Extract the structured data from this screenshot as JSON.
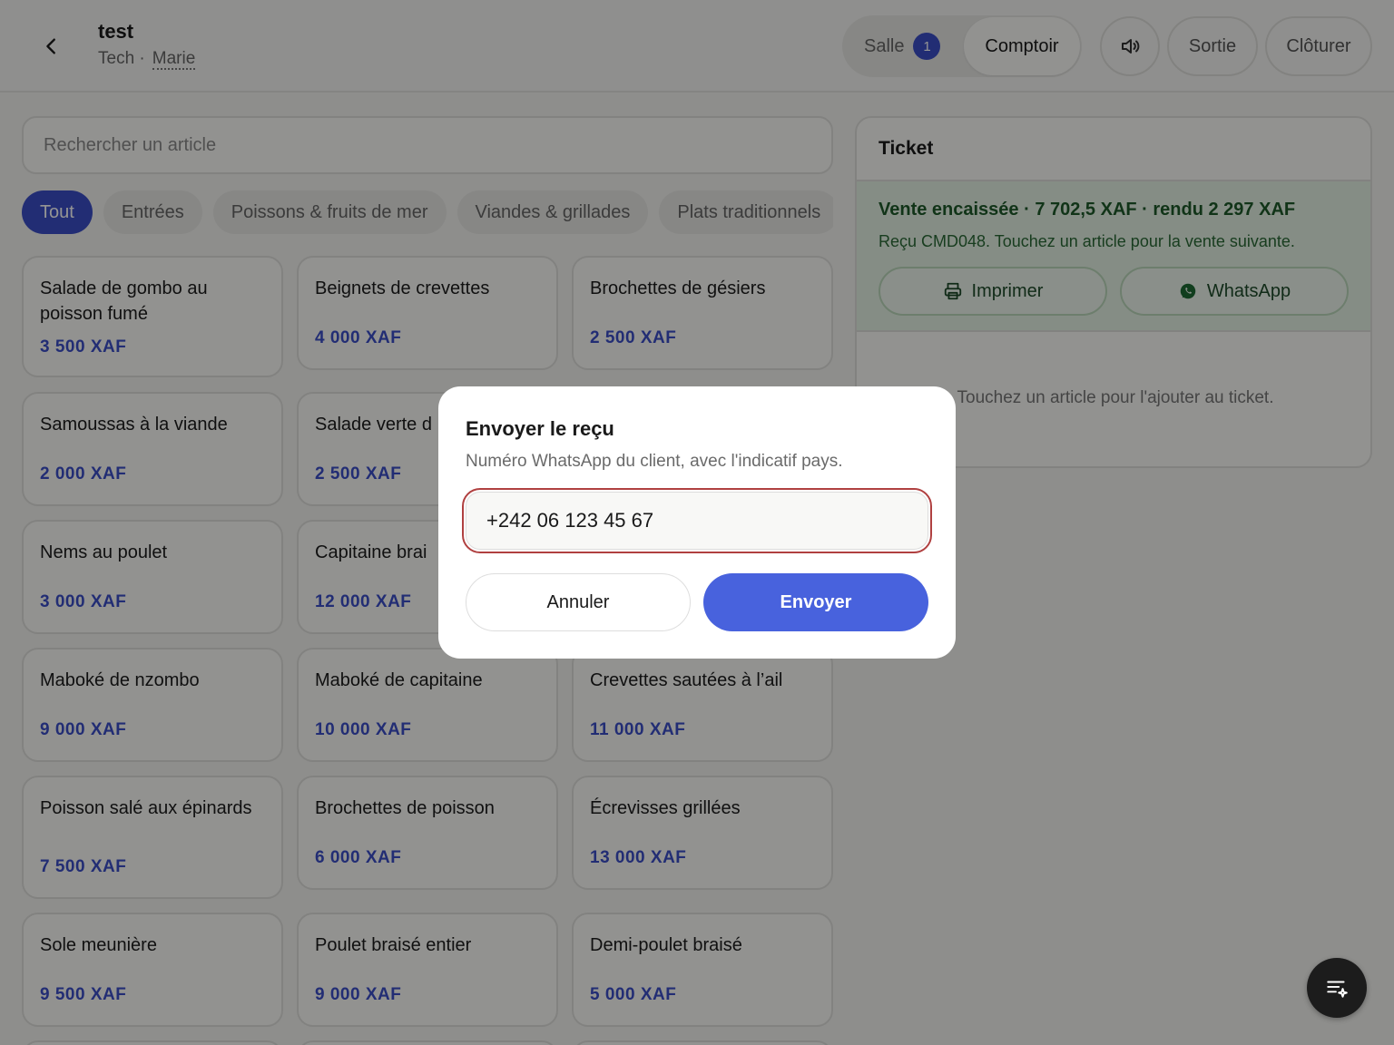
{
  "header": {
    "title": "test",
    "subtitle_role": "Tech ·",
    "subtitle_user": "Marie",
    "mode_salle": "Salle",
    "mode_salle_badge": "1",
    "mode_comptoir": "Comptoir",
    "sound_icon": "speaker-icon",
    "sortie_label": "Sortie",
    "cloturer_label": "Clôturer"
  },
  "search": {
    "placeholder": "Rechercher un article"
  },
  "categories": [
    {
      "label": "Tout",
      "active": true
    },
    {
      "label": "Entrées"
    },
    {
      "label": "Poissons & fruits de mer"
    },
    {
      "label": "Viandes & grillades"
    },
    {
      "label": "Plats traditionnels"
    }
  ],
  "products": [
    {
      "name": "Salade de gombo au poisson fumé",
      "price": "3 500 XAF"
    },
    {
      "name": "Beignets de crevettes",
      "price": "4 000 XAF"
    },
    {
      "name": "Brochettes de gésiers",
      "price": "2 500 XAF"
    },
    {
      "name": "Samoussas à la viande",
      "price": "2 000 XAF"
    },
    {
      "name": "Salade verte d",
      "price": "2 500 XAF"
    },
    {
      "name": "",
      "price": ""
    },
    {
      "name": "Nems au poulet",
      "price": "3 000 XAF"
    },
    {
      "name": "Capitaine brai",
      "price": "12 000 XAF"
    },
    {
      "name": "",
      "price": ""
    },
    {
      "name": "Maboké de nzombo",
      "price": "9 000 XAF"
    },
    {
      "name": "Maboké de capitaine",
      "price": "10 000 XAF"
    },
    {
      "name": "Crevettes sautées à l’ail",
      "price": "11 000 XAF"
    },
    {
      "name": "Poisson salé aux épinards",
      "price": "7 500 XAF"
    },
    {
      "name": "Brochettes de poisson",
      "price": "6 000 XAF"
    },
    {
      "name": "Écrevisses grillées",
      "price": "13 000 XAF"
    },
    {
      "name": "Sole meunière",
      "price": "9 500 XAF"
    },
    {
      "name": "Poulet braisé entier",
      "price": "9 000 XAF"
    },
    {
      "name": "Demi-poulet braisé",
      "price": "5 000 XAF"
    }
  ],
  "ticket": {
    "title": "Ticket",
    "success_title": "Vente encaissée · 7 702,5 XAF · rendu 2 297 XAF",
    "success_text": "Reçu CMD048. Touchez un article pour la vente suivante.",
    "print_label": "Imprimer",
    "whatsapp_label": "WhatsApp",
    "empty_text": "Touchez un article pour l'ajouter au ticket."
  },
  "dialog": {
    "title": "Envoyer le reçu",
    "subtitle": "Numéro WhatsApp du client, avec l'indicatif pays.",
    "phone_value": "+242 06 123 45 67",
    "cancel_label": "Annuler",
    "send_label": "Envoyer"
  },
  "colors": {
    "accent": "#3c4fc9",
    "send_button": "#4862dd",
    "success_bg": "#e6f3e6",
    "input_border": "#b04040"
  }
}
